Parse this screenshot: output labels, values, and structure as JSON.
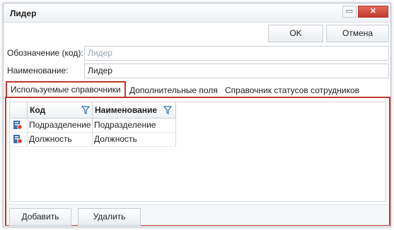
{
  "window": {
    "title": "Лидер"
  },
  "toolbar": {
    "ok_label": "OK",
    "cancel_label": "Отмена"
  },
  "form": {
    "code_label": "Обозначение (код):",
    "code_placeholder": "Лидер",
    "name_label": "Наименование:",
    "name_value": "Лидер"
  },
  "tabs": [
    {
      "label": "Используемые справочники",
      "active": true
    },
    {
      "label": "Дополнительные поля",
      "active": false
    },
    {
      "label": "Справочник статусов сотрудников",
      "active": false
    }
  ],
  "grid": {
    "columns": [
      "Код",
      "Наименование"
    ],
    "rows": [
      {
        "code": "Подразделение",
        "name": "Подразделение"
      },
      {
        "code": "Должность",
        "name": "Должность"
      }
    ]
  },
  "footer": {
    "add_label": "Добавить",
    "delete_label": "Удалить"
  },
  "colors": {
    "highlight": "#c0392b",
    "close": "#c4382c"
  }
}
